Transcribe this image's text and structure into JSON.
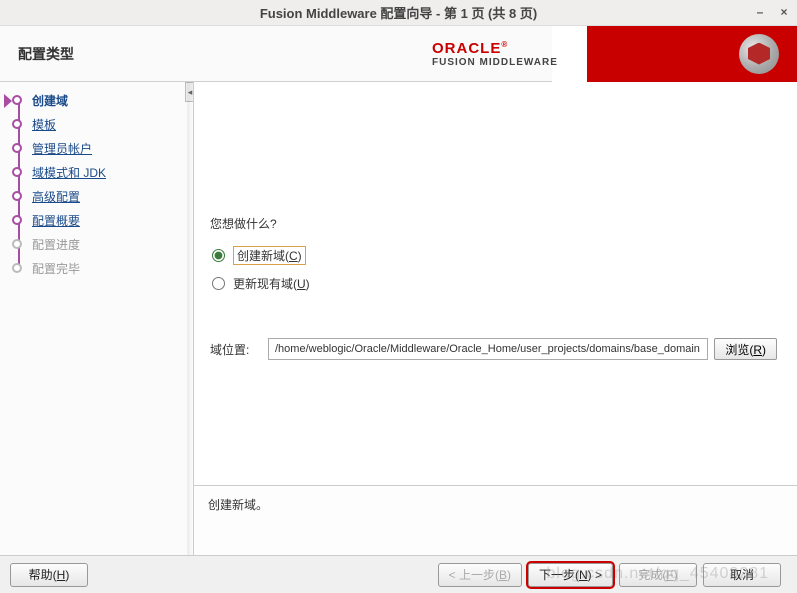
{
  "window": {
    "title": "Fusion Middleware 配置向导 - 第 1 页 (共 8 页)",
    "minimize_tooltip": "最小化",
    "close_tooltip": "关闭"
  },
  "header": {
    "page_name": "配置类型",
    "brand_name": "ORACLE",
    "brand_sub": "FUSION MIDDLEWARE"
  },
  "sidebar": {
    "steps": [
      {
        "label": "创建域",
        "state": "current"
      },
      {
        "label": "模板",
        "state": "link"
      },
      {
        "label": "管理员帐户",
        "state": "link"
      },
      {
        "label": "域模式和 JDK",
        "state": "link"
      },
      {
        "label": "高级配置",
        "state": "link"
      },
      {
        "label": "配置概要",
        "state": "link"
      },
      {
        "label": "配置进度",
        "state": "disabled"
      },
      {
        "label": "配置完毕",
        "state": "disabled"
      }
    ]
  },
  "content": {
    "question": "您想做什么?",
    "option_create": "创建新域(C)",
    "option_create_key": "C",
    "option_update": "更新现有域(U)",
    "option_update_key": "U",
    "path_label": "域位置:",
    "path_value": "/home/weblogic/Oracle/Middleware/Oracle_Home/user_projects/domains/base_domain",
    "browse_label": "浏览(R)",
    "browse_key": "R",
    "selected_option": "create"
  },
  "status": {
    "message": "创建新域。"
  },
  "footer": {
    "help": "帮助(H)",
    "help_key": "H",
    "back": "< 上一步(B)",
    "back_key": "B",
    "next": "下一步(N) >",
    "next_key": "N",
    "finish": "完成(F)",
    "finish_key": "F",
    "cancel": "取消"
  },
  "watermark": "blog.csdn.net/qq_45408281"
}
